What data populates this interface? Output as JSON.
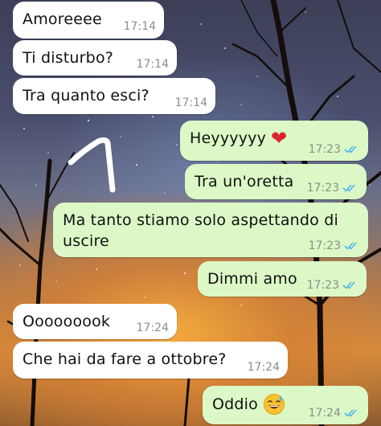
{
  "messages": [
    {
      "id": "m1",
      "side": "in",
      "text": "Amoreeee",
      "time": "17:14"
    },
    {
      "id": "m2",
      "side": "in",
      "text": "Ti disturbo?",
      "time": "17:14"
    },
    {
      "id": "m3",
      "side": "in",
      "text": "Tra quanto esci?",
      "time": "17:14"
    },
    {
      "id": "m4",
      "side": "out",
      "text": "Heyyyyyy",
      "emoji": "red-heart",
      "time": "17:23",
      "status": "read"
    },
    {
      "id": "m5",
      "side": "out",
      "text": "Tra un'oretta",
      "time": "17:23",
      "status": "read"
    },
    {
      "id": "m6",
      "side": "out",
      "text": "Ma tanto stiamo solo aspettando di\nuscire",
      "time": "17:23",
      "status": "read"
    },
    {
      "id": "m7",
      "side": "out",
      "text": "Dimmi amo",
      "time": "17:23",
      "status": "read"
    },
    {
      "id": "m8",
      "side": "in",
      "text": "Ooooooook",
      "time": "17:24"
    },
    {
      "id": "m9",
      "side": "in",
      "text": "Che hai da fare a ottobre?",
      "time": "17:24"
    },
    {
      "id": "m10",
      "side": "out",
      "text": "Oddio",
      "emoji": "grinning-sweat",
      "time": "17:24",
      "status": "read"
    }
  ],
  "colors": {
    "incoming_bubble": "#ffffff",
    "outgoing_bubble": "#dcf8c6",
    "read_ticks": "#4fb6ec",
    "timestamp": "#8a8f8a"
  }
}
